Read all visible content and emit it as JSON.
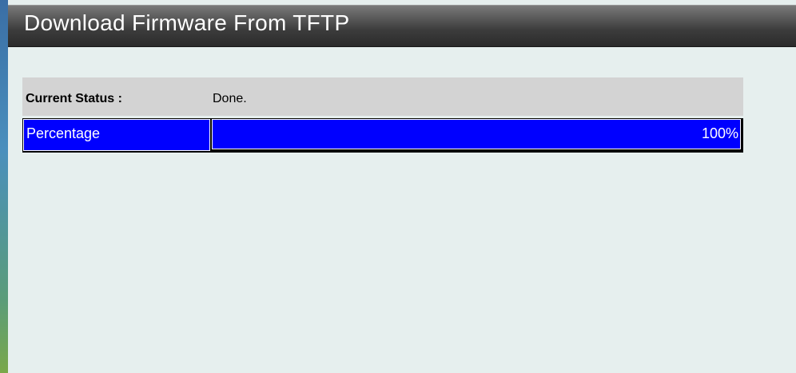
{
  "header": {
    "title": "Download Firmware From TFTP"
  },
  "status": {
    "label": "Current Status :",
    "value": "Done."
  },
  "progress": {
    "label": "Percentage",
    "value_text": "100%",
    "percent": 100
  },
  "colors": {
    "progress_fill": "#0000ff",
    "status_row_bg": "#d3d3d3",
    "page_bg": "#e6efee"
  }
}
